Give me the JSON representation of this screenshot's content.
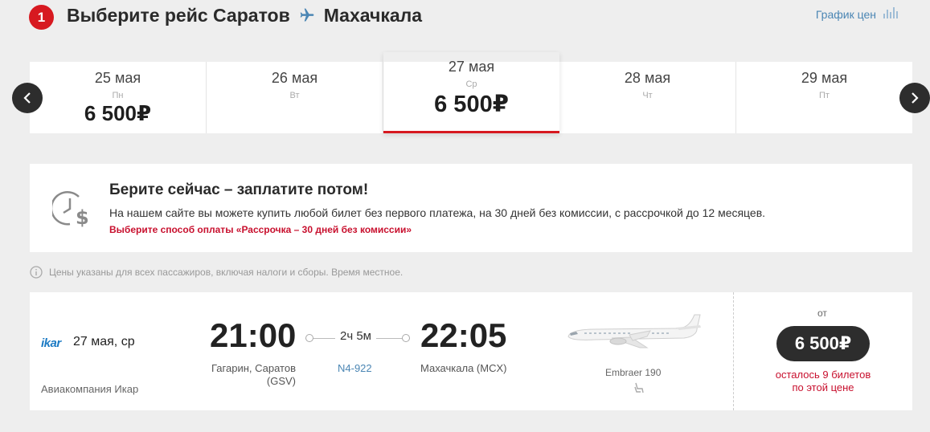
{
  "header": {
    "step_number": "1",
    "title_prefix": "Выберите рейс Саратов",
    "title_destination": "Махачкала",
    "price_graph_label": "График цен"
  },
  "dates": [
    {
      "date": "25 мая",
      "weekday": "Пн",
      "price": "6 500₽",
      "active": false
    },
    {
      "date": "26 мая",
      "weekday": "Вт",
      "price": "",
      "active": false
    },
    {
      "date": "27 мая",
      "weekday": "Ср",
      "price": "6 500₽",
      "active": true
    },
    {
      "date": "28 мая",
      "weekday": "Чт",
      "price": "",
      "active": false
    },
    {
      "date": "29 мая",
      "weekday": "Пт",
      "price": "",
      "active": false
    }
  ],
  "promo": {
    "title": "Берите сейчас – заплатите потом!",
    "text": "На нашем сайте вы можете купить любой билет без первого платежа, на 30 дней без комиссии, с рассрочкой до 12 месяцев.",
    "link": "Выберите способ оплаты «Рассрочка – 30 дней без комиссии»"
  },
  "notice": "Цены указаны для всех пассажиров, включая налоги и сборы. Время местное.",
  "flight": {
    "airline_logo": "ikar",
    "date": "27 мая, ср",
    "airline_name": "Авиакомпания Икар",
    "departure_time": "21:00",
    "departure_place_line1": "Гагарин, Саратов",
    "departure_place_line2": "(GSV)",
    "duration": "2ч 5м",
    "flight_number": "N4-922",
    "arrival_time": "22:05",
    "arrival_place": "Махачкала (MCX)",
    "aircraft": "Embraer 190",
    "price_from": "от",
    "price": "6 500₽",
    "seats_line1": "осталось 9 билетов",
    "seats_line2": "по этой цене"
  },
  "colors": {
    "accent_red": "#d71920",
    "link_blue": "#4b86b4",
    "dark": "#2d2d2d"
  }
}
